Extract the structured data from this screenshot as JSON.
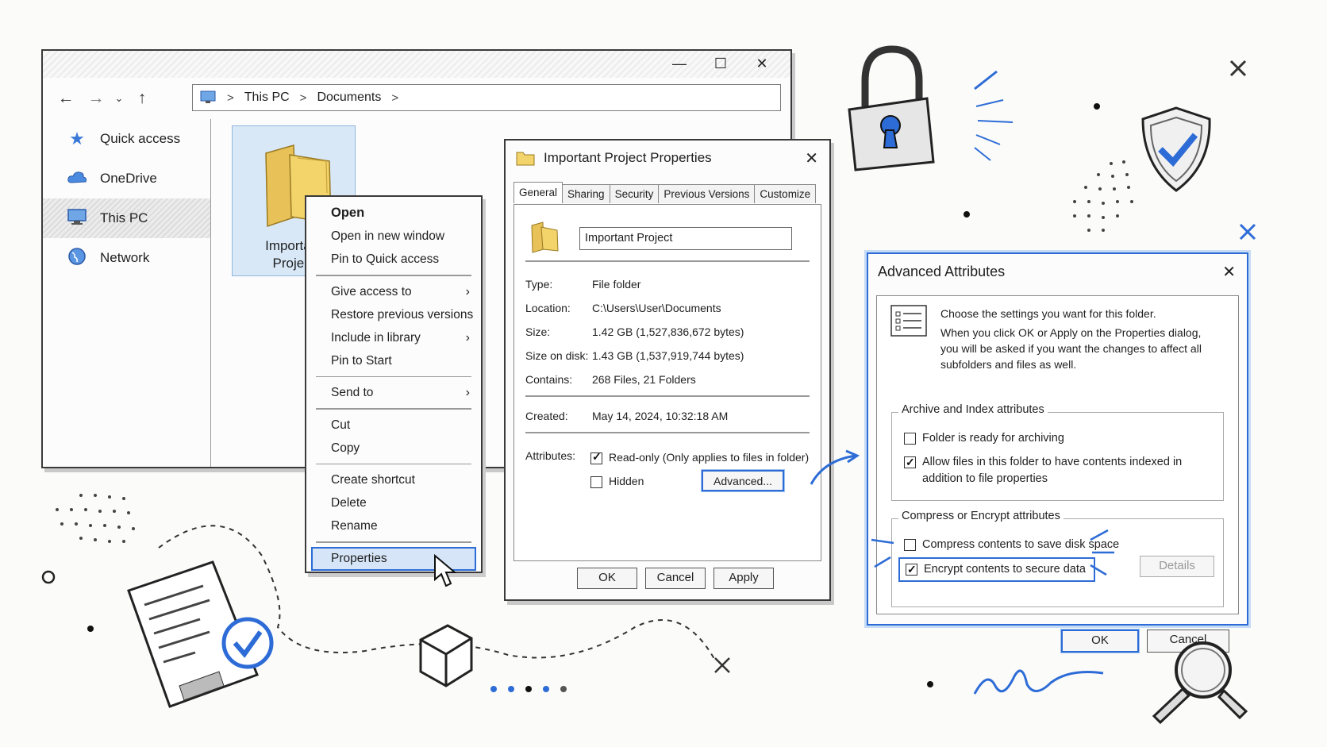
{
  "explorer": {
    "breadcrumb": [
      "This PC",
      "Documents"
    ],
    "sidebar": [
      {
        "label": "Quick access",
        "icon": "star-icon"
      },
      {
        "label": "OneDrive",
        "icon": "cloud-icon"
      },
      {
        "label": "This PC",
        "icon": "monitor-icon"
      },
      {
        "label": "Network",
        "icon": "globe-icon"
      }
    ],
    "folder_label_1": "Important",
    "folder_label_2": "Project"
  },
  "context_menu": {
    "items": [
      "Open",
      "Open in new window",
      "Pin to Quick access",
      "Give access to",
      "Restore previous versions",
      "Include in library",
      "Pin to Start",
      "Send to",
      "Cut",
      "Copy",
      "Create shortcut",
      "Delete",
      "Rename",
      "Properties"
    ]
  },
  "properties": {
    "title": "Important Project Properties",
    "tabs": [
      "General",
      "Sharing",
      "Security",
      "Previous Versions",
      "Customize"
    ],
    "name_value": "Important Project",
    "rows": [
      {
        "key": "Type:",
        "value": "File folder"
      },
      {
        "key": "Location:",
        "value": "C:\\Users\\User\\Documents"
      },
      {
        "key": "Size:",
        "value": "1.42 GB (1,527,836,672 bytes)"
      },
      {
        "key": "Size on disk:",
        "value": "1.43 GB (1,537,919,744 bytes)"
      },
      {
        "key": "Contains:",
        "value": "268 Files, 21 Folders"
      }
    ],
    "created_key": "Created:",
    "created_value": "May 14, 2024, 10:32:18 AM",
    "attributes_key": "Attributes:",
    "readonly_label": "Read-only (Only applies to files in folder)",
    "hidden_label": "Hidden",
    "advanced_button": "Advanced...",
    "ok": "OK",
    "cancel": "Cancel",
    "apply": "Apply"
  },
  "advanced": {
    "title": "Advanced Attributes",
    "intro_1": "Choose the settings you want for this folder.",
    "intro_2": "When you click OK or Apply on the Properties dialog, you will be asked if you want the changes to affect all subfolders and files as well.",
    "archive_group": "Archive and Index attributes",
    "archive_cb": "Folder is ready for archiving",
    "index_cb": "Allow files in this folder to have contents indexed in addition to file properties",
    "compress_group": "Compress or Encrypt attributes",
    "compress_cb": "Compress contents to save disk space",
    "encrypt_cb": "Encrypt contents to secure data",
    "details": "Details",
    "ok": "OK",
    "cancel": "Cancel"
  },
  "colors": {
    "accent": "#2d6cd6",
    "folder": "#f2d46b"
  }
}
